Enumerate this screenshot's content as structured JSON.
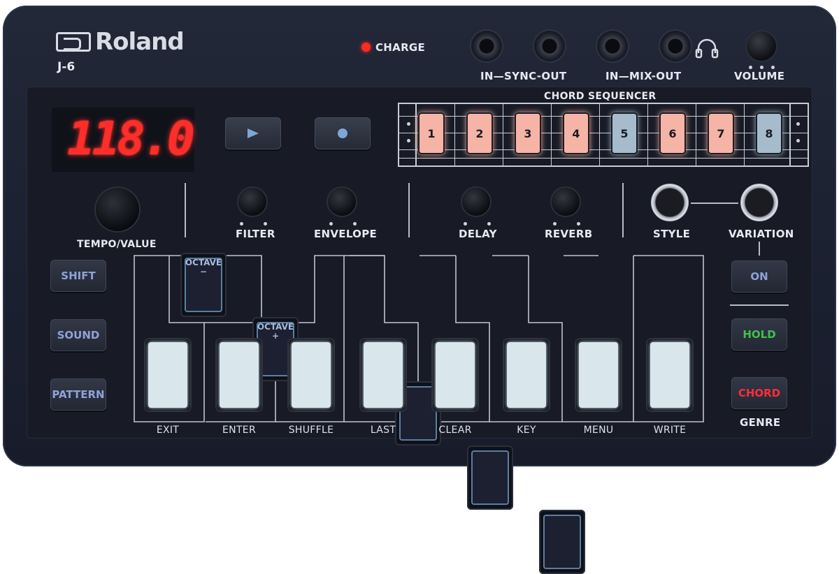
{
  "brand": {
    "logo": "Roland",
    "model": "J-6"
  },
  "indicator": {
    "charge_label": "CHARGE",
    "charge_color": "#ff2a20"
  },
  "io": {
    "sync_label": "IN—SYNC-OUT",
    "mix_label": "IN—MIX-OUT",
    "volume_label": "VOLUME"
  },
  "display": {
    "value": "118.0"
  },
  "transport": {
    "play_icon": "play-icon",
    "record_icon": "record-icon"
  },
  "sequencer": {
    "title": "CHORD SEQUENCER",
    "steps": [
      {
        "label": "1",
        "color": "#f6b4a6"
      },
      {
        "label": "2",
        "color": "#f6b4a6"
      },
      {
        "label": "3",
        "color": "#f6b4a6"
      },
      {
        "label": "4",
        "color": "#f6b4a6"
      },
      {
        "label": "5",
        "color": "#a6bccd"
      },
      {
        "label": "6",
        "color": "#f6b4a6"
      },
      {
        "label": "7",
        "color": "#f6b4a6"
      },
      {
        "label": "8",
        "color": "#a6bccd"
      }
    ]
  },
  "knobs": {
    "tempo_value": "TEMPO/VALUE",
    "filter": "FILTER",
    "envelope": "ENVELOPE",
    "delay": "DELAY",
    "reverb": "REVERB",
    "style": "STYLE",
    "variation": "VARIATION"
  },
  "side_buttons": {
    "shift": "SHIFT",
    "sound": "SOUND",
    "pattern": "PATTERN"
  },
  "right_buttons": {
    "on": "ON",
    "hold": "HOLD",
    "chord": "CHORD",
    "genre": "GENRE",
    "hold_color": "#3ec24a",
    "chord_color": "#ff2d3a"
  },
  "octave": {
    "word": "OCTAVE",
    "minus": "−",
    "plus": "+"
  },
  "keys": {
    "labels": [
      "EXIT",
      "ENTER",
      "SHUFFLE",
      "LAST",
      "CLEAR",
      "KEY",
      "MENU",
      "WRITE"
    ]
  }
}
